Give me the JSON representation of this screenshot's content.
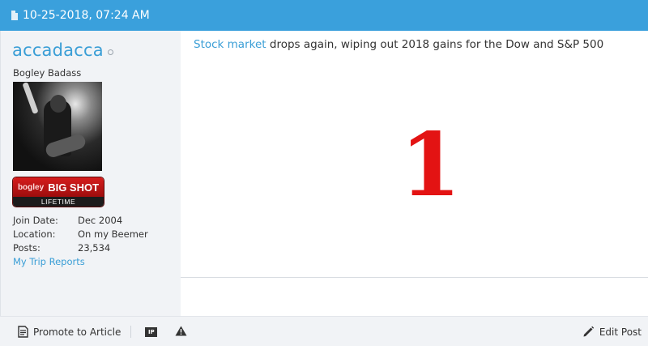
{
  "header": {
    "timestamp": "10-25-2018, 07:24 AM",
    "icon": "document-icon"
  },
  "user": {
    "name": "accadacca",
    "status_icon": "offline-circle-icon",
    "title": "Bogley Badass",
    "badge": {
      "brand": "bogley",
      "label": "BIG SHOT",
      "sub": "LIFETIME"
    },
    "info": [
      {
        "label": "Join Date:",
        "value": "Dec 2004"
      },
      {
        "label": "Location:",
        "value": "On my Beemer"
      },
      {
        "label": "Posts:",
        "value": "23,534"
      }
    ],
    "trip_link": "My Trip Reports"
  },
  "post": {
    "link_text": "Stock market",
    "title_rest": " drops again, wiping out 2018 gains for the Dow and S&P 500",
    "big_text": "1"
  },
  "footer": {
    "promote_label": "Promote to Article",
    "ip_label": "IP",
    "edit_label": "Edit Post"
  },
  "colors": {
    "accent": "#3aa0dc",
    "link": "#3a9ed6",
    "big_number": "#e31313",
    "panel_bg": "#f1f3f6"
  }
}
